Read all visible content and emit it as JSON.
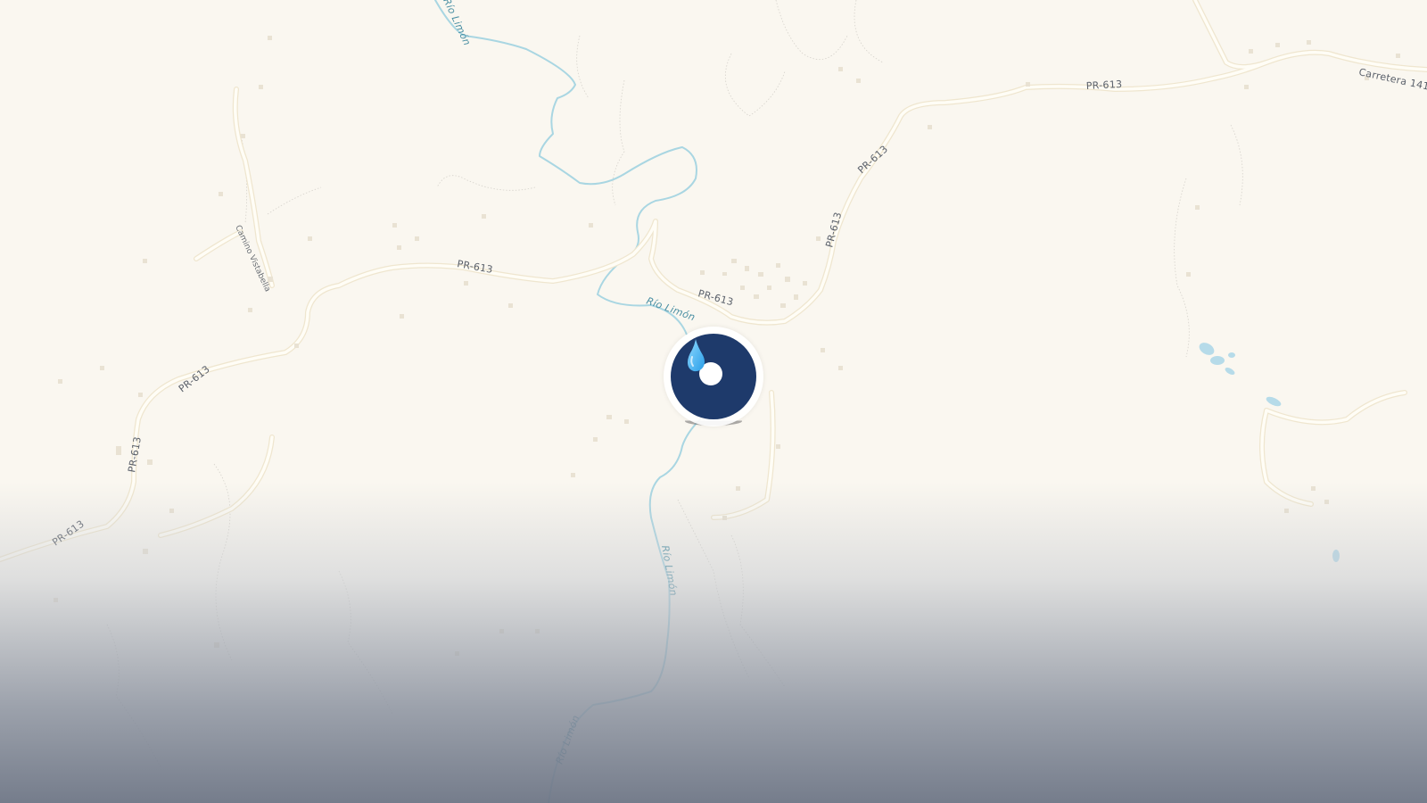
{
  "map": {
    "colors": {
      "land": "#faf7f0",
      "road": "#fffdf6",
      "road_edge": "#efe6cf",
      "river": "#a9d6e2",
      "river_label": "#4a8fa3",
      "marker": "#1e3a6b",
      "drop": "#4cb8f0"
    },
    "roads": [
      {
        "label": "PR-613"
      },
      {
        "label": "PR-613"
      },
      {
        "label": "PR-613"
      },
      {
        "label": "PR-613"
      },
      {
        "label": "PR-613"
      },
      {
        "label": "PR-613"
      },
      {
        "label": "PR-613"
      },
      {
        "label": "PR-613"
      },
      {
        "label": "Carretera 141"
      },
      {
        "label": "Camino Vistabella"
      }
    ],
    "rivers": [
      {
        "label": "Río Limón"
      },
      {
        "label": "Río Limón"
      },
      {
        "label": "Río Limón"
      },
      {
        "label": "Río Limón"
      }
    ],
    "marker": {
      "icon": "water-drop-icon"
    }
  }
}
